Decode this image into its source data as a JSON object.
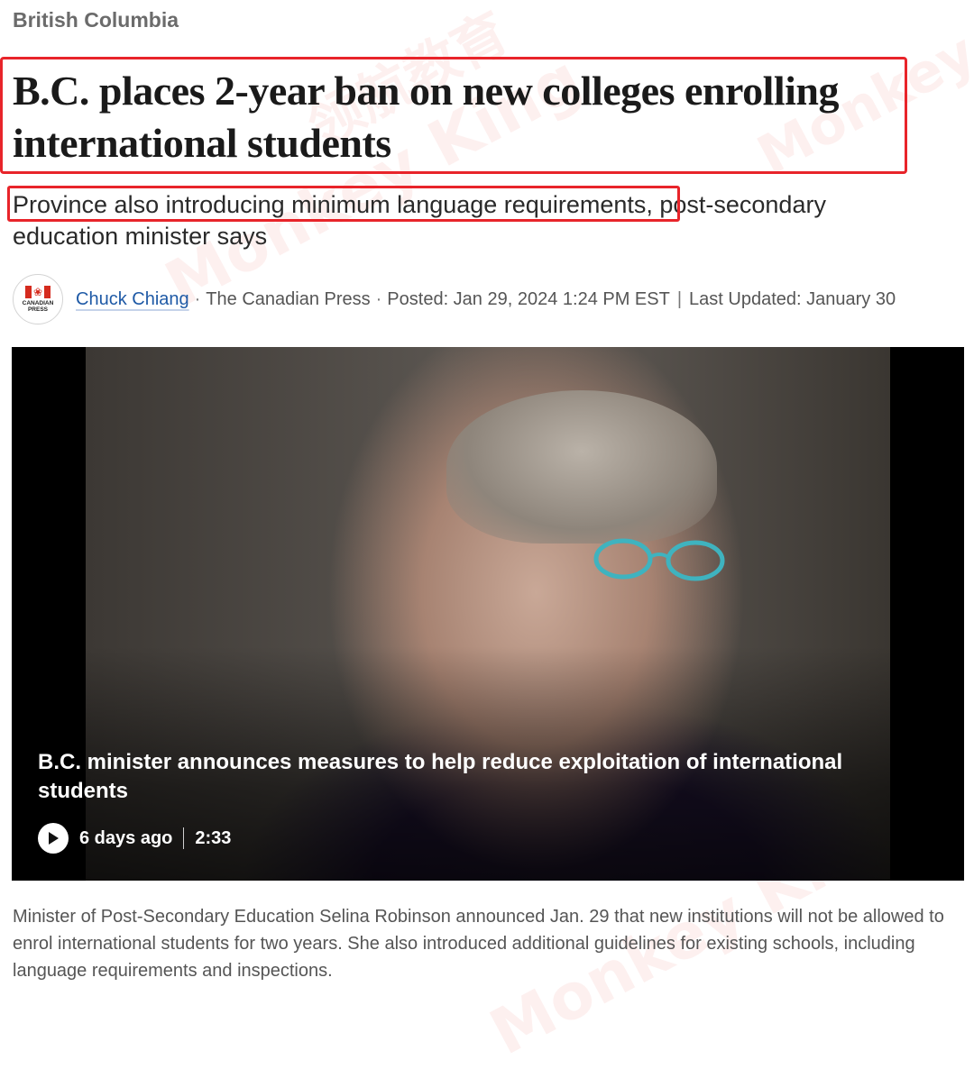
{
  "article": {
    "section": "British Columbia",
    "headline": "B.C. places 2-year ban on new colleges enrolling international students",
    "subhead_highlighted": "Province also introducing minimum language requirements,",
    "subhead_rest": " post-secondary education minister says",
    "byline": {
      "logo_text": "CANADIAN\nPRESS",
      "author": "Chuck Chiang",
      "source": "The Canadian Press",
      "posted": "Posted: Jan 29, 2024 1:24 PM EST",
      "updated": "Last Updated: January 30"
    },
    "video": {
      "title": "B.C. minister announces measures to help reduce exploitation of international students",
      "age": "6 days ago",
      "duration": "2:33"
    },
    "caption": "Minister of Post-Secondary Education Selina Robinson announced Jan. 29 that new institutions will not be allowed to enrol international students for two years. She also introduced additional guidelines for existing schools, including language requirements and inspections."
  },
  "annotations": {
    "highlight_color": "#e8242a"
  },
  "watermark": {
    "brand": "Monkey King",
    "cn": "领航教育"
  },
  "colors": {
    "link": "#1f5aa6",
    "section": "#6b6b6b",
    "video_bg": "#000000"
  }
}
